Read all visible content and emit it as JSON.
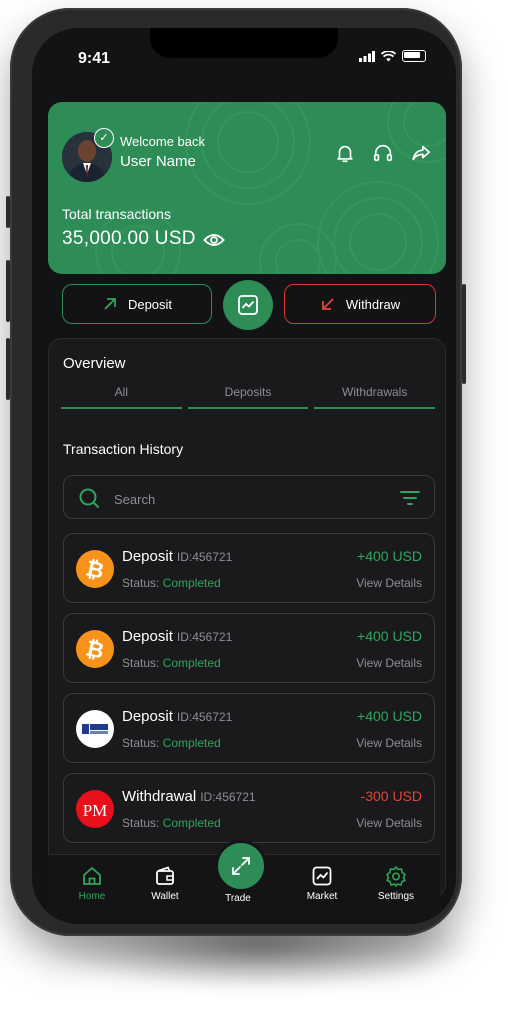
{
  "status_bar": {
    "time": "9:41"
  },
  "header": {
    "welcome": "Welcome back",
    "user_name": "User Name",
    "total_label": "Total transactions",
    "total_amount": "35,000.00 USD",
    "icons": [
      "bell-icon",
      "headset-icon",
      "share-icon",
      "eye-icon",
      "verified-check-icon"
    ]
  },
  "actions": {
    "deposit_label": "Deposit",
    "withdraw_label": "Withdraw"
  },
  "overview": {
    "title": "Overview",
    "tabs": [
      {
        "label": "All"
      },
      {
        "label": "Deposits"
      },
      {
        "label": "Withdrawals"
      }
    ]
  },
  "history": {
    "title": "Transaction History",
    "search_placeholder": "Search",
    "status_prefix": "Status:",
    "items": [
      {
        "type": "Deposit",
        "id": "ID:456721",
        "status": "Completed",
        "amount": "+400 USD",
        "link": "View Details",
        "logo": "bitcoin-logo"
      },
      {
        "type": "Deposit",
        "id": "ID:456721",
        "status": "Completed",
        "amount": "+400 USD",
        "link": "View Details",
        "logo": "bitcoin-logo"
      },
      {
        "type": "Deposit",
        "id": "ID:456721",
        "status": "Completed",
        "amount": "+400 USD",
        "link": "View Details",
        "logo": "icm-capital-logo"
      },
      {
        "type": "Withdrawal",
        "id": "ID:456721",
        "status": "Completed",
        "amount": "-300 USD",
        "link": "View Details",
        "logo": "perfect-money-logo"
      }
    ]
  },
  "nav": {
    "home": "Home",
    "wallet": "Wallet",
    "trade": "Trade",
    "market": "Market",
    "settings": "Settings"
  },
  "colors": {
    "accent": "#2e8d57",
    "positive": "#2fa55c",
    "negative": "#e0443c",
    "background": "#131315"
  }
}
